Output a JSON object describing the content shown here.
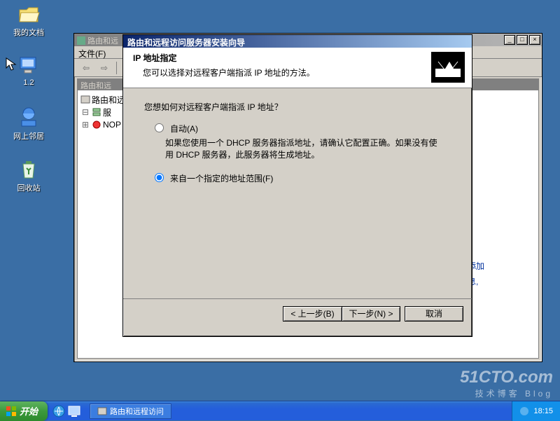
{
  "desktop": {
    "icons": [
      {
        "label": "我的文档"
      },
      {
        "label": "1.2"
      },
      {
        "label": "网上邻居"
      },
      {
        "label": "回收站"
      }
    ]
  },
  "mmc": {
    "title": "路由和远",
    "menu": {
      "file": "文件(F)"
    },
    "child_title": "路由和远",
    "tree": {
      "root": "路由和远",
      "srv": "服",
      "nop": "NOP"
    }
  },
  "wizard": {
    "title": "路由和远程访问服务器安装向导",
    "heading": "IP 地址指定",
    "subheading": "您可以选择对远程客户端指派 IP 地址的方法。",
    "question": "您想如何对远程客户端指派 IP 地址？",
    "opt_auto": "自动(A)",
    "opt_auto_desc": "如果您使用一个 DHCP 服务器指派地址，请确认它配置正确。如果没有使用 DHCP 服务器，此服务器将生成地址。",
    "opt_range": "来自一个指定的地址范围(F)",
    "selected": "range",
    "buttons": {
      "back": "< 上一步(B)",
      "next": "下一步(N) >",
      "cancel": "取消"
    }
  },
  "side_peek": {
    "l1": "添加",
    "l2": "息,"
  },
  "taskbar": {
    "start": "开始",
    "task": "路由和远程访问",
    "clock": "18:15"
  },
  "watermark": {
    "big": "51CTO.com",
    "small": "技术博客  Blog"
  }
}
